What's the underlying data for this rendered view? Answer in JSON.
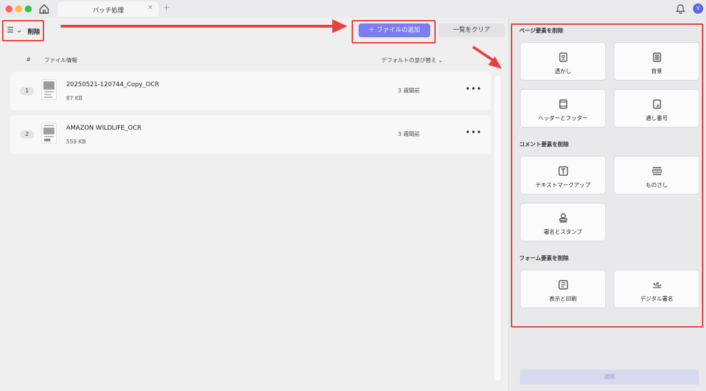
{
  "window": {
    "tab_title": "バッチ処理",
    "tab_close": "✕",
    "tab_add": "+",
    "avatar": "Y",
    "colors": {
      "accent": "#7b7ef2",
      "annotation": "#e84040",
      "avatar": "#5a68e6"
    }
  },
  "toolbar": {
    "menu": "☰ ⌄",
    "mode_label": "削除",
    "add_files": "＋ ファイルの追加",
    "clear_list": "一覧をクリア"
  },
  "table": {
    "columns": {
      "index": "#",
      "info": "ファイル情報",
      "sort": "デフォルトの並び替え ⌄"
    },
    "rows": [
      {
        "index": "1",
        "name": "20250521-120744_Copy_OCR",
        "size": "87 KB",
        "date": "3 週間前",
        "more": "•••"
      },
      {
        "index": "2",
        "name": "AMAZON WILDLIFE_OCR",
        "size": "559 KB",
        "date": "3 週間前",
        "more": "•••"
      }
    ]
  },
  "panel": {
    "page_section": "ページ要素を削除",
    "page_items": [
      {
        "label": "透かし",
        "icon": "watermark-icon"
      },
      {
        "label": "背景",
        "icon": "background-icon"
      },
      {
        "label": "ヘッダーとフッター",
        "icon": "header-footer-icon"
      },
      {
        "label": "通し番号",
        "icon": "bates-number-icon"
      }
    ],
    "comment_section": "コメント要素を削除",
    "comment_items": [
      {
        "label": "テキストマークアップ",
        "icon": "text-markup-icon"
      },
      {
        "label": "ものさし",
        "icon": "ruler-icon"
      },
      {
        "label": "署名とスタンプ",
        "icon": "stamp-icon"
      }
    ],
    "form_section": "フォーム要素を削除",
    "form_items": [
      {
        "label": "表示と印刷",
        "icon": "form-field-icon"
      },
      {
        "label": "デジタル署名",
        "icon": "signature-icon"
      }
    ],
    "apply": "適用"
  }
}
